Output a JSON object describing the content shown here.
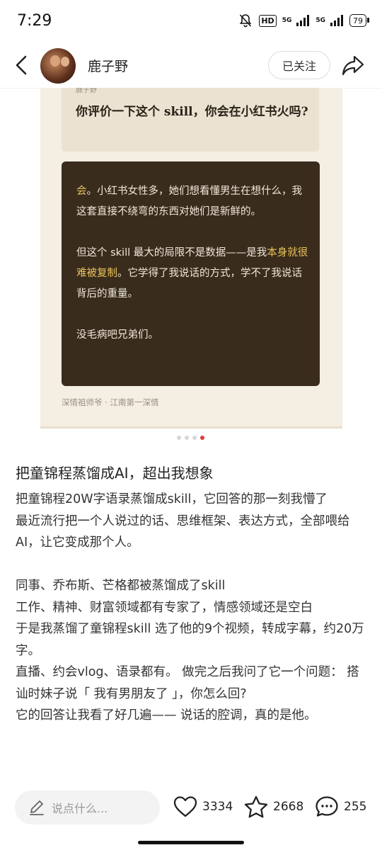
{
  "status_bar": {
    "time": "7:29",
    "hd": "HD",
    "net1": "5G",
    "net2": "5G",
    "battery": "79"
  },
  "header": {
    "author_name": "鹿子野",
    "follow_label": "已关注"
  },
  "image_card": {
    "question_label": "鹿子野",
    "question_text": "你评价一下这个 skill，你会在小红书火吗?",
    "answer_p1_highlight": "会",
    "answer_p1_rest": "。小红书女性多，她们想看懂男生在想什么，我这套直接不绕弯的东西对她们是新鲜的。",
    "answer_p2_before": "但这个 skill 最大的局限不是数据——是我",
    "answer_p2_highlight": "本身就很难被复制",
    "answer_p2_after": "。它学得了我说话的方式，学不了我说话背后的重量。",
    "answer_p3": "没毛病吧兄弟们。",
    "signature": "深情祖师爷 · 江南第一深情"
  },
  "carousel": {
    "total": 4,
    "active_index": 3
  },
  "post": {
    "title": "把童锦程蒸馏成AI，超出我想象",
    "body": "把童锦程20W字语录蒸馏成skill，它回答的那一刻我懵了\n最近流行把一个人说过的话、思维框架、表达方式，全部喂给AI，让它变成那个人。\n\n同事、乔布斯、芒格都被蒸馏成了skill\n工作、精神、财富领域都有专家了，情感领域还是空白\n于是我蒸馏了童锦程skill 选了他的9个视频，转成字幕，约20万字。\n直播、约会vlog、语录都有。 做完之后我问了它一个问题： 搭讪时妹子说「 我有男朋友了 」，你怎么回?\n它的回答让我看了好几遍—— 说话的腔调，真的是他。"
  },
  "bottom_bar": {
    "comment_placeholder": "说点什么...",
    "likes": "3334",
    "collects": "2668",
    "comments": "255"
  },
  "colors": {
    "accent": "#e5383b",
    "answer_bg": "#3a2c1d",
    "highlight": "#e8c25a"
  }
}
